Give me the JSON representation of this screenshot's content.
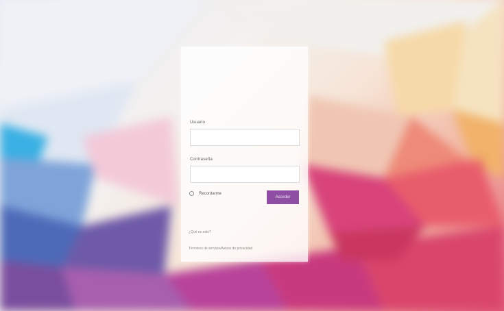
{
  "login": {
    "username_label": "Usuario",
    "username_value": "",
    "password_label": "Contraseña",
    "password_value": "",
    "remember_label": "Recordarme",
    "submit_label": "Acceder"
  },
  "links": {
    "what_is_this": "¿Qué es esto?",
    "privacy_terms": "Términos de servicio/Avisos de privacidad"
  },
  "colors": {
    "accent": "#8e4fa2",
    "panel": "#ffffff"
  }
}
